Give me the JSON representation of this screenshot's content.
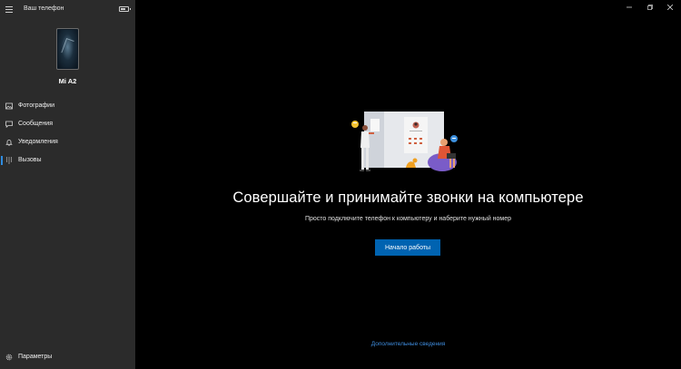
{
  "app": {
    "title": "Ваш телефон"
  },
  "device": {
    "name": "Mi A2"
  },
  "sidebar": {
    "items": [
      {
        "label": "Фотографии",
        "icon": "photos-icon",
        "active": false
      },
      {
        "label": "Сообщения",
        "icon": "messages-icon",
        "active": false
      },
      {
        "label": "Уведомления",
        "icon": "bell-icon",
        "active": false
      },
      {
        "label": "Вызовы",
        "icon": "dialpad-icon",
        "active": true
      }
    ],
    "settings_label": "Параметры"
  },
  "main": {
    "headline": "Совершайте и принимайте звонки на компьютере",
    "subtext": "Просто подключите телефон к компьютеру и наберите нужный номер",
    "primary_button": "Начало работы",
    "more_link": "Дополнительные сведения"
  },
  "colors": {
    "sidebar_bg": "#2b2b2b",
    "main_bg": "#000000",
    "accent": "#0063b1",
    "link": "#3f8ee0"
  }
}
